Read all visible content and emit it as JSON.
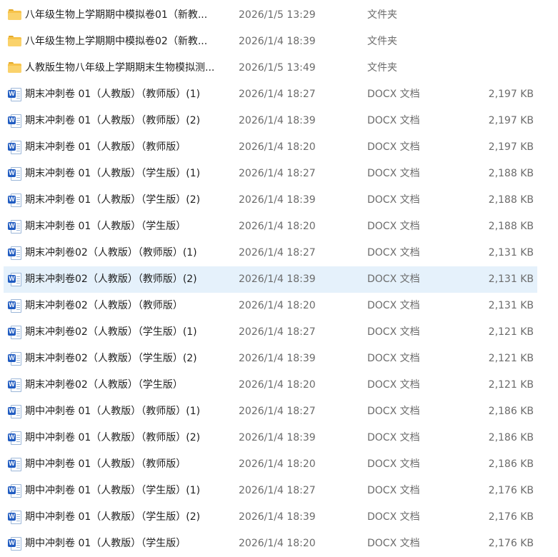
{
  "files": [
    {
      "name": "八年级生物上学期期中模拟卷01（新教...",
      "date": "2026/1/5 13:29",
      "type": "文件夹",
      "size": "",
      "icon": "folder-icon"
    },
    {
      "name": "八年级生物上学期期中模拟卷02（新教...",
      "date": "2026/1/4 18:39",
      "type": "文件夹",
      "size": "",
      "icon": "folder-icon"
    },
    {
      "name": "人教版生物八年级上学期期末生物模拟测...",
      "date": "2026/1/5 13:49",
      "type": "文件夹",
      "size": "",
      "icon": "folder-icon"
    },
    {
      "name": "期末冲刺卷 01（人教版）（教师版）(1)",
      "date": "2026/1/4 18:27",
      "type": "DOCX 文档",
      "size": "2,197 KB",
      "icon": "word-doc-icon"
    },
    {
      "name": "期末冲刺卷 01（人教版）（教师版）(2)",
      "date": "2026/1/4 18:39",
      "type": "DOCX 文档",
      "size": "2,197 KB",
      "icon": "word-doc-icon"
    },
    {
      "name": "期末冲刺卷 01（人教版）（教师版）",
      "date": "2026/1/4 18:20",
      "type": "DOCX 文档",
      "size": "2,197 KB",
      "icon": "word-doc-icon"
    },
    {
      "name": "期末冲刺卷 01（人教版）（学生版）(1)",
      "date": "2026/1/4 18:27",
      "type": "DOCX 文档",
      "size": "2,188 KB",
      "icon": "word-doc-icon"
    },
    {
      "name": "期末冲刺卷 01（人教版）（学生版）(2)",
      "date": "2026/1/4 18:39",
      "type": "DOCX 文档",
      "size": "2,188 KB",
      "icon": "word-doc-icon"
    },
    {
      "name": "期末冲刺卷 01（人教版）（学生版）",
      "date": "2026/1/4 18:20",
      "type": "DOCX 文档",
      "size": "2,188 KB",
      "icon": "word-doc-icon"
    },
    {
      "name": "期末冲刺卷02（人教版）（教师版）(1)",
      "date": "2026/1/4 18:27",
      "type": "DOCX 文档",
      "size": "2,131 KB",
      "icon": "word-doc-icon"
    },
    {
      "name": "期末冲刺卷02（人教版）（教师版）(2)",
      "date": "2026/1/4 18:39",
      "type": "DOCX 文档",
      "size": "2,131 KB",
      "icon": "word-doc-icon",
      "selected": true
    },
    {
      "name": "期末冲刺卷02（人教版）（教师版）",
      "date": "2026/1/4 18:20",
      "type": "DOCX 文档",
      "size": "2,131 KB",
      "icon": "word-doc-icon"
    },
    {
      "name": "期末冲刺卷02（人教版）（学生版）(1)",
      "date": "2026/1/4 18:27",
      "type": "DOCX 文档",
      "size": "2,121 KB",
      "icon": "word-doc-icon"
    },
    {
      "name": "期末冲刺卷02（人教版）（学生版）(2)",
      "date": "2026/1/4 18:39",
      "type": "DOCX 文档",
      "size": "2,121 KB",
      "icon": "word-doc-icon"
    },
    {
      "name": "期末冲刺卷02（人教版）（学生版）",
      "date": "2026/1/4 18:20",
      "type": "DOCX 文档",
      "size": "2,121 KB",
      "icon": "word-doc-icon"
    },
    {
      "name": "期中冲刺卷 01（人教版）（教师版）(1)",
      "date": "2026/1/4 18:27",
      "type": "DOCX 文档",
      "size": "2,186 KB",
      "icon": "word-doc-icon"
    },
    {
      "name": "期中冲刺卷 01（人教版）（教师版）(2)",
      "date": "2026/1/4 18:39",
      "type": "DOCX 文档",
      "size": "2,186 KB",
      "icon": "word-doc-icon"
    },
    {
      "name": "期中冲刺卷 01（人教版）（教师版）",
      "date": "2026/1/4 18:20",
      "type": "DOCX 文档",
      "size": "2,186 KB",
      "icon": "word-doc-icon"
    },
    {
      "name": "期中冲刺卷 01（人教版）（学生版）(1)",
      "date": "2026/1/4 18:27",
      "type": "DOCX 文档",
      "size": "2,176 KB",
      "icon": "word-doc-icon"
    },
    {
      "name": "期中冲刺卷 01（人教版）（学生版）(2)",
      "date": "2026/1/4 18:39",
      "type": "DOCX 文档",
      "size": "2,176 KB",
      "icon": "word-doc-icon"
    },
    {
      "name": "期中冲刺卷 01（人教版）（学生版）",
      "date": "2026/1/4 18:20",
      "type": "DOCX 文档",
      "size": "2,176 KB",
      "icon": "word-doc-icon"
    }
  ],
  "word_badge": "W",
  "colors": {
    "selection": "#e5f1fb",
    "folder": "#f7c34a",
    "word": "#1f5bc1",
    "meta_text": "#6b6b6b"
  }
}
